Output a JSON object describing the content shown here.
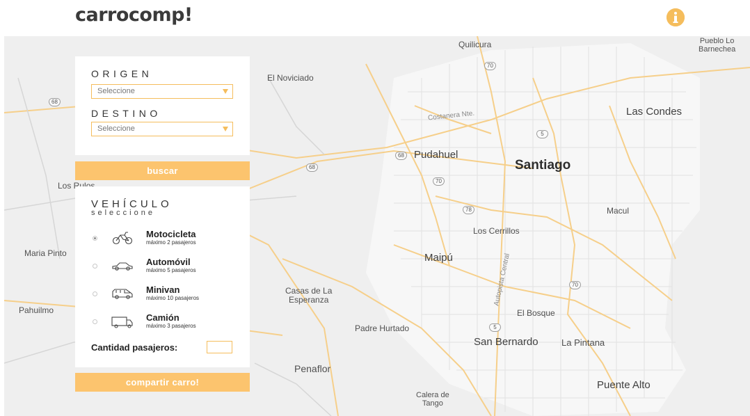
{
  "app": {
    "logo": "carrocomp!"
  },
  "header": {
    "info_icon": "info-icon",
    "accent": "#f5bd5c"
  },
  "route": {
    "origin_label": "ORIGEN",
    "origin_value": "Seleccione",
    "destination_label": "DESTINO",
    "destination_value": "Seleccione",
    "search_label": "buscar"
  },
  "vehicle": {
    "title": "VEHÍCULO",
    "subtitle": "seleccione",
    "options": [
      {
        "name": "Motocicleta",
        "capacity": "máximo 2 pasajeros",
        "icon": "motorcycle-icon",
        "selected": true
      },
      {
        "name": "Automóvil",
        "capacity": "máximo 5 pasajeros",
        "icon": "car-icon",
        "selected": false
      },
      {
        "name": "Minivan",
        "capacity": "máximo 10 pasajeros",
        "icon": "minivan-icon",
        "selected": false
      },
      {
        "name": "Camión",
        "capacity": "máximo 3 pasajeros",
        "icon": "truck-icon",
        "selected": false
      }
    ],
    "passengers_label": "Cantidad pasajeros:",
    "passengers_value": "",
    "share_label": "compartir carro!"
  },
  "map": {
    "places": {
      "quilicura": "Quilicura",
      "pueblo_lo": "Pueblo Lo",
      "barnechea": "Barnechea",
      "el_noviciado": "El Noviciado",
      "costanera": "Costanera Nte.",
      "las_condes": "Las Condes",
      "pudahuel": "Pudahuel",
      "santiago": "Santiago",
      "los_rulos": "Los Rulos",
      "macul": "Macul",
      "los_cerrillos": "Los Cerrillos",
      "maria_pinto": "Maria Pinto",
      "maipu": "Maipú",
      "autopista": "Autopista Central",
      "casas_1": "Casas de La",
      "casas_2": "Esperanza",
      "pahuilmo": "Pahuilmo",
      "el_bosque": "El Bosque",
      "padre_hurtado": "Padre Hurtado",
      "san_bernardo": "San Bernardo",
      "la_pintana": "La Pintana",
      "penaflor": "Penaflor",
      "puente_alto": "Puente Alto",
      "calera_1": "Calera de",
      "calera_2": "Tango"
    },
    "shields": {
      "s68a": "68",
      "s68b": "68",
      "s68c": "68",
      "s70a": "70",
      "s70b": "70",
      "s70c": "70",
      "s5a": "5",
      "s5b": "5",
      "s78": "78"
    }
  }
}
